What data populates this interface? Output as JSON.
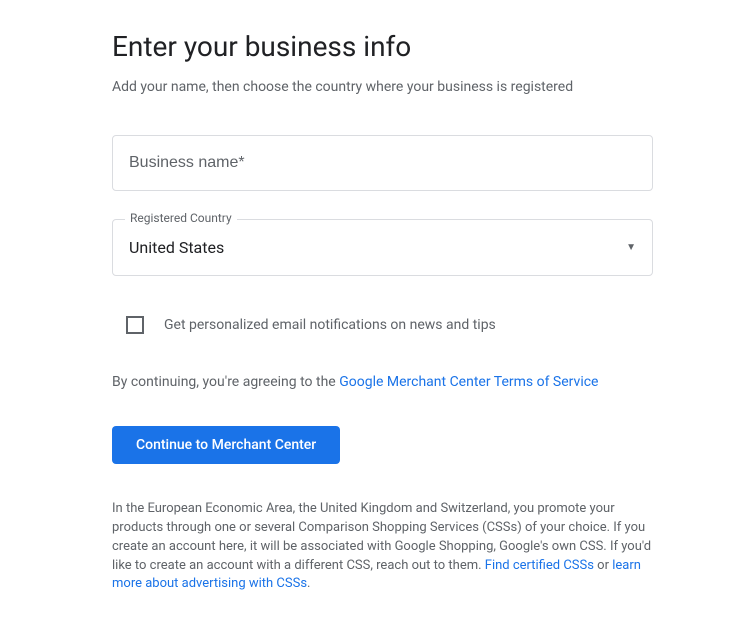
{
  "header": {
    "title": "Enter your business info",
    "subtitle": "Add your name, then choose the country where your business is registered"
  },
  "form": {
    "business_name_placeholder": "Business name*",
    "business_name_value": "",
    "country_label": "Registered Country",
    "country_value": "United States",
    "checkbox_label": "Get personalized email notifications on news and tips"
  },
  "agreement": {
    "prefix": "By continuing, you're agreeing to the ",
    "link_text": "Google Merchant Center Terms of Service"
  },
  "button": {
    "continue_label": "Continue to Merchant Center"
  },
  "footer": {
    "text": "In the European Economic Area, the United Kingdom and Switzerland, you promote your products through one or several Comparison Shopping Services (CSSs) of your choice. If you create an account here, it will be associated with Google Shopping, Google's own CSS. If you'd like to create an account with a different CSS, reach out to them. ",
    "link1": "Find certified CSSs",
    "connector": " or ",
    "link2": "learn more about advertising with CSSs",
    "suffix": "."
  }
}
